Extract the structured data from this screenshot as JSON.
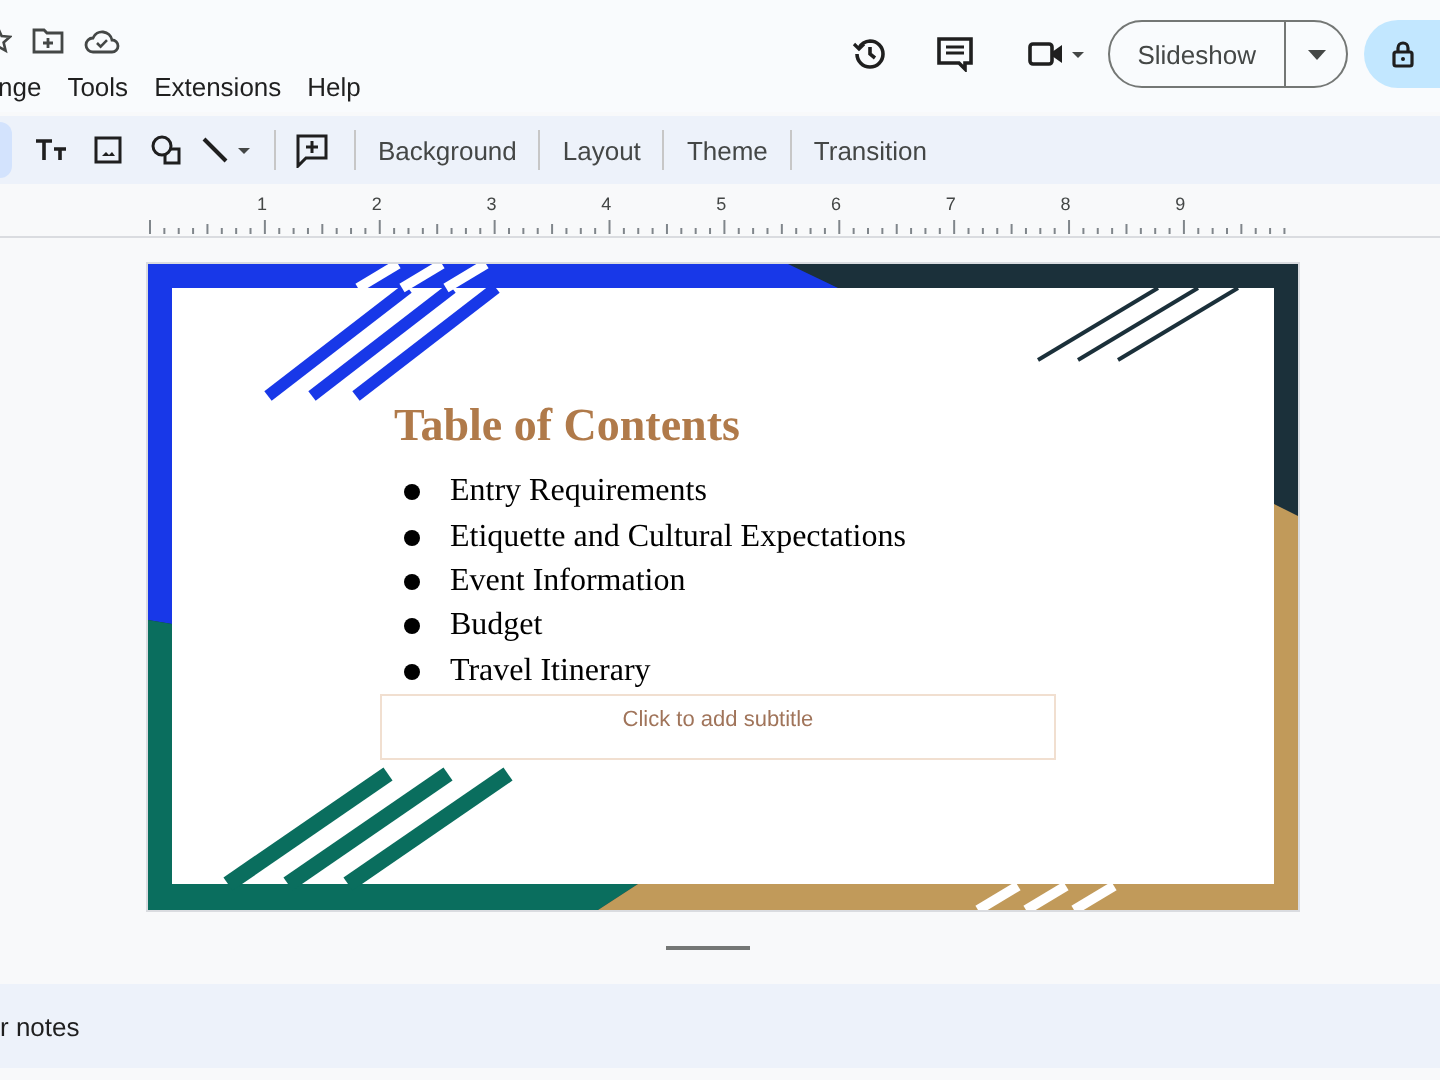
{
  "menu": [
    "nge",
    "Tools",
    "Extensions",
    "Help"
  ],
  "slideshow_button": {
    "label": "Slideshow"
  },
  "toolbar": {
    "buttons": [
      "Background",
      "Layout",
      "Theme",
      "Transition"
    ]
  },
  "ruler": {
    "labels": [
      "1",
      "2",
      "3",
      "4",
      "5",
      "6",
      "7",
      "8",
      "9"
    ]
  },
  "slide": {
    "title": "Table of Contents",
    "bullets": [
      "Entry Requirements",
      "Etiquette and Cultural Expectations",
      "Event Information",
      "Budget",
      "Travel Itinerary"
    ],
    "subtitle": {
      "placeholder": "Click to add subtitle"
    }
  },
  "notes": {
    "placeholder": "r notes"
  }
}
